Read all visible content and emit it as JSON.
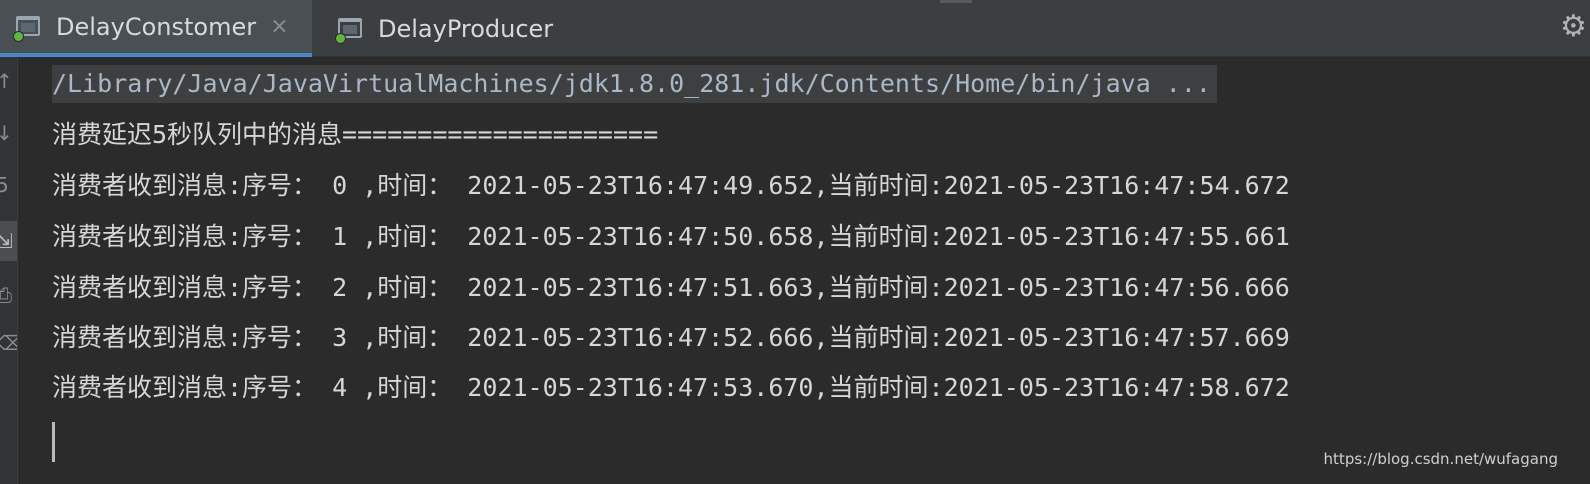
{
  "tabs": [
    {
      "label": "DelayConstomer",
      "active": true,
      "close": "×"
    },
    {
      "label": "DelayProducer",
      "active": false
    }
  ],
  "toolbar": {
    "gear_glyph": "⚙"
  },
  "gutter": {
    "icons": [
      {
        "name": "up-arrow-icon",
        "glyph": "↑"
      },
      {
        "name": "down-arrow-icon",
        "glyph": "↓"
      },
      {
        "name": "rerun-icon",
        "glyph": "5"
      },
      {
        "name": "soft-wrap-icon",
        "glyph": "⇲"
      },
      {
        "name": "print-icon",
        "glyph": "⎙"
      },
      {
        "name": "delete-icon",
        "glyph": "⌫"
      }
    ]
  },
  "console": {
    "command": "/Library/Java/JavaVirtualMachines/jdk1.8.0_281.jdk/Contents/Home/bin/java ...",
    "lines": [
      "消费延迟5秒队列中的消息=====================",
      "消费者收到消息:序号： 0 ,时间： 2021-05-23T16:47:49.652,当前时间:2021-05-23T16:47:54.672",
      "消费者收到消息:序号： 1 ,时间： 2021-05-23T16:47:50.658,当前时间:2021-05-23T16:47:55.661",
      "消费者收到消息:序号： 2 ,时间： 2021-05-23T16:47:51.663,当前时间:2021-05-23T16:47:56.666",
      "消费者收到消息:序号： 3 ,时间： 2021-05-23T16:47:52.666,当前时间:2021-05-23T16:47:57.669",
      "消费者收到消息:序号： 4 ,时间： 2021-05-23T16:47:53.670,当前时间:2021-05-23T16:47:58.672"
    ]
  },
  "watermark": "https://blog.csdn.net/wufagang",
  "colors": {
    "background": "#2b2b2b",
    "tab_active_underline": "#4a88c7",
    "run_indicator": "#62b543",
    "text": "#d4d6d8"
  }
}
